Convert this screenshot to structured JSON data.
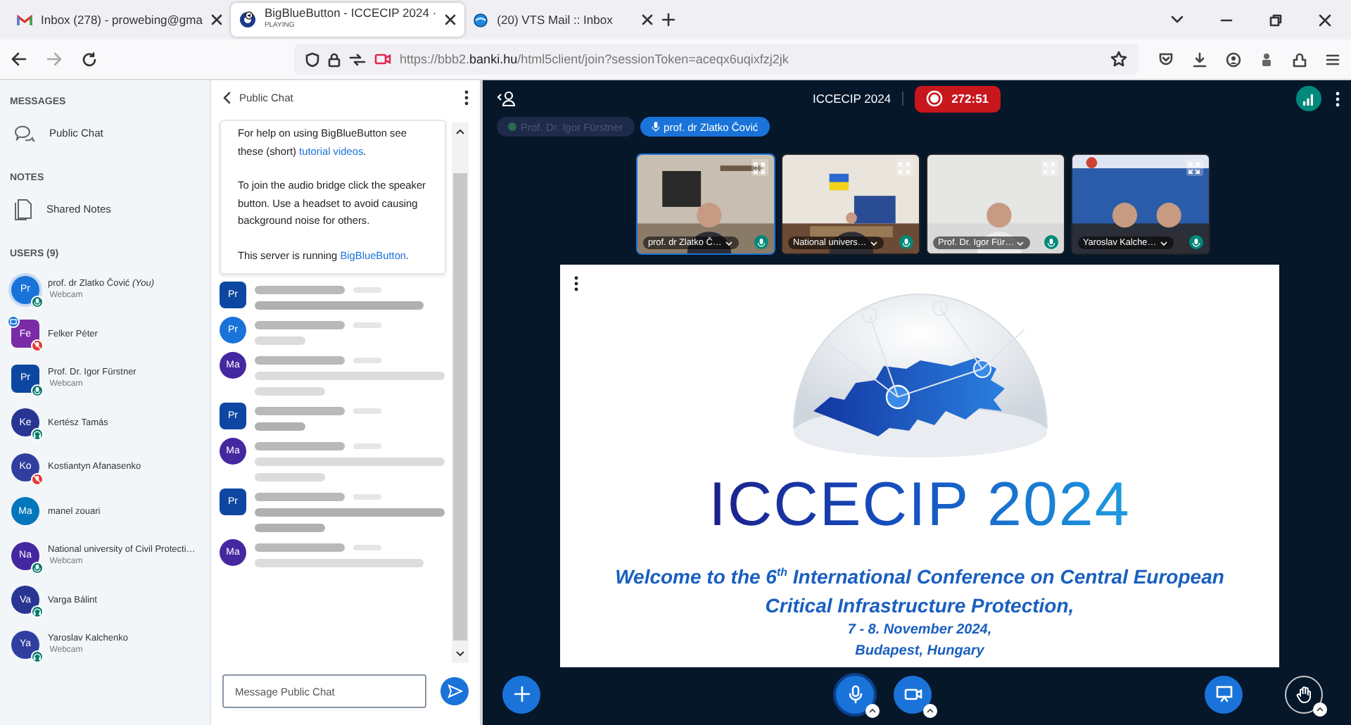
{
  "browser": {
    "tabs": [
      {
        "kind": "gmail",
        "title": "Inbox (278) - prowebing@gma",
        "selected": false
      },
      {
        "kind": "bbb",
        "title": "BigBlueButton - ICCECIP 2024 ·",
        "subtitle": "PLAYING",
        "selected": true
      },
      {
        "kind": "vts",
        "title": "(20) VTS Mail :: Inbox",
        "selected": false
      }
    ],
    "url": {
      "before": "https://bbb2.",
      "host": "banki.hu",
      "after": "/html5client/join?sessionToken=aceqx6uqixfzj2jk"
    }
  },
  "sidebar": {
    "messages_heading": "MESSAGES",
    "public_chat": "Public Chat",
    "notes_heading": "NOTES",
    "shared_notes": "Shared Notes",
    "users_heading": "USERS (9)",
    "users": [
      {
        "kind": "mic",
        "initials": "Pr",
        "name": "prof. dr Zlatko Čović",
        "you": "(You)",
        "sub": "Webcam",
        "color": "#1a73d9",
        "moderator": false,
        "presenter": false
      },
      {
        "kind": "muted",
        "initials": "Fe",
        "name": "Felker Péter",
        "color": "#7b2ba5",
        "moderator": true,
        "presenter": true
      },
      {
        "kind": "mic",
        "initials": "Pr",
        "name": "Prof. Dr. Igor Fürstner",
        "sub": "Webcam",
        "color": "#0d47a1",
        "moderator": true,
        "presenter": false
      },
      {
        "kind": "listen",
        "initials": "Ke",
        "name": "Kertész Tamás",
        "color": "#283593",
        "moderator": false,
        "presenter": false
      },
      {
        "kind": "muted",
        "initials": "Ko",
        "name": "Kostiantyn Afanasenko",
        "color": "#303f9f",
        "moderator": false,
        "presenter": false
      },
      {
        "kind": "none",
        "initials": "Ma",
        "name": "manel zouari",
        "color": "#0277bd",
        "moderator": false,
        "presenter": false
      },
      {
        "kind": "mic",
        "initials": "Na",
        "name": "National university of Civil Protecti…",
        "sub": "Webcam",
        "color": "#4527a0",
        "moderator": false,
        "presenter": false
      },
      {
        "kind": "listen",
        "initials": "Va",
        "name": "Varga Bálint",
        "color": "#283593",
        "moderator": false,
        "presenter": false
      },
      {
        "kind": "listen",
        "initials": "Ya",
        "name": "Yaroslav Kalchenko",
        "sub": "Webcam",
        "color": "#303f9f",
        "moderator": false,
        "presenter": false
      }
    ]
  },
  "chat": {
    "title": "Public Chat",
    "welcome": [
      [
        {
          "text": "For help on using BigBlueButton see these (short) "
        },
        {
          "link": "tutorial videos"
        },
        {
          "text": "."
        }
      ],
      [
        {
          "text": "To join the audio bridge click the speaker button. Use a headset to avoid causing background noise for others."
        }
      ],
      [
        {
          "text": "This server is running "
        },
        {
          "link": "BigBlueButton"
        },
        {
          "text": "."
        }
      ]
    ],
    "messages": [
      {
        "initials": "Pr",
        "color": "#0d47a1",
        "moderator": true,
        "kind": "one_line",
        "bold": true
      },
      {
        "initials": "Pr",
        "color": "#1a73d9",
        "moderator": false,
        "kind": "short",
        "bold": false
      },
      {
        "initials": "Ma",
        "color": "#4527a0",
        "moderator": false,
        "kind": "two_line",
        "bold": false
      },
      {
        "initials": "Pr",
        "color": "#0d47a1",
        "moderator": true,
        "kind": "short",
        "bold": true
      },
      {
        "initials": "Ma",
        "color": "#4527a0",
        "moderator": false,
        "kind": "two_line",
        "bold": false
      },
      {
        "initials": "Pr",
        "color": "#0d47a1",
        "moderator": true,
        "kind": "two_line",
        "bold": true
      },
      {
        "initials": "Ma",
        "color": "#4527a0",
        "moderator": false,
        "kind": "one_line",
        "bold": false
      }
    ],
    "input": {
      "placeholder": "Message Public Chat"
    }
  },
  "meeting": {
    "title": "ICCECIP 2024",
    "recording": "272:51",
    "talkers": [
      {
        "name": "Prof. Dr. Igor Fürstner",
        "talking": false
      },
      {
        "name": "prof. dr Zlatko Čović",
        "talking": true
      }
    ],
    "videos": [
      {
        "name": "prof. dr Zlatko Č…",
        "selected": true,
        "kind": "picture"
      },
      {
        "name": "National univers…",
        "selected": false,
        "kind": "picture"
      },
      {
        "name": "Prof. Dr. Igor Für…",
        "selected": false,
        "kind": "picture"
      },
      {
        "name": "Yaroslav Kalche…",
        "selected": false,
        "kind": "picture"
      }
    ],
    "slide": {
      "title": "ICCECIP 2024",
      "welcome": "Welcome to the 6$^{th}$ International Conference on Central European Critical Infrastructure Protection,",
      "dates": "7 - 8. November 2024,",
      "place": "Budapest, Hungary"
    }
  }
}
